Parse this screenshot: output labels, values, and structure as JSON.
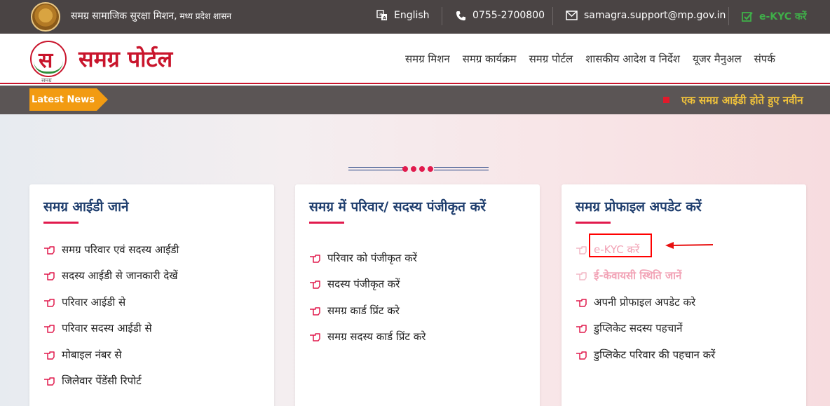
{
  "topbar": {
    "org_title": "समग्र सामाजिक सुरक्षा मिशन,",
    "org_sub": " मध्य प्रदेश शासन",
    "language": "English",
    "phone": "0755-2700800",
    "email": "samagra.support@mp.gov.in",
    "ekyc": "e-KYC करें"
  },
  "header": {
    "brand": "समग्र पोर्टल",
    "logo_caption": "समग्र",
    "nav": [
      "समग्र मिशन",
      "समग्र कार्यक्रम",
      "समग्र पोर्टल",
      "शासकीय आदेश व निर्देश",
      "यूजर मैनुअल",
      "संपर्क"
    ]
  },
  "news": {
    "label": "Latest News",
    "ticker": "एक समग्र आईडी होते हुए नवीन"
  },
  "cards": [
    {
      "title": "समग्र आईडी जाने",
      "items": [
        "समग्र परिवार एवं सदस्य आईडी",
        "सदस्य आईडी से जानकारी देखें",
        "परिवार आईडी से",
        "परिवार सदस्य आईडी से",
        "मोबाइल नंबर से",
        "जिलेवार पेंडेंसी रिपोर्ट"
      ]
    },
    {
      "title": "समग्र में परिवार/ सदस्य पंजीकृत करें",
      "items": [
        "परिवार को पंजीकृत करें",
        "सदस्य पंजीकृत करें",
        "समग्र कार्ड प्रिंट करे",
        "समग्र सदस्य कार्ड प्रिंट करे"
      ]
    },
    {
      "title": "समग्र प्रोफाइल अपडेट करें",
      "items": [
        "e-KYC करें",
        "ई-केवायसी स्थिति जानें",
        "अपनी प्रोफाइल अपडेट करे",
        "डुप्लिकेट सदस्य पहचानें",
        "डुप्लिकेट परिवार की पहचान करें"
      ]
    }
  ],
  "colors": {
    "accent": "#c9152c",
    "topbar_bg": "#4a4444",
    "news_label": "#f29b12",
    "ticker": "#f3c43b",
    "card_title": "#1f3e6e"
  }
}
